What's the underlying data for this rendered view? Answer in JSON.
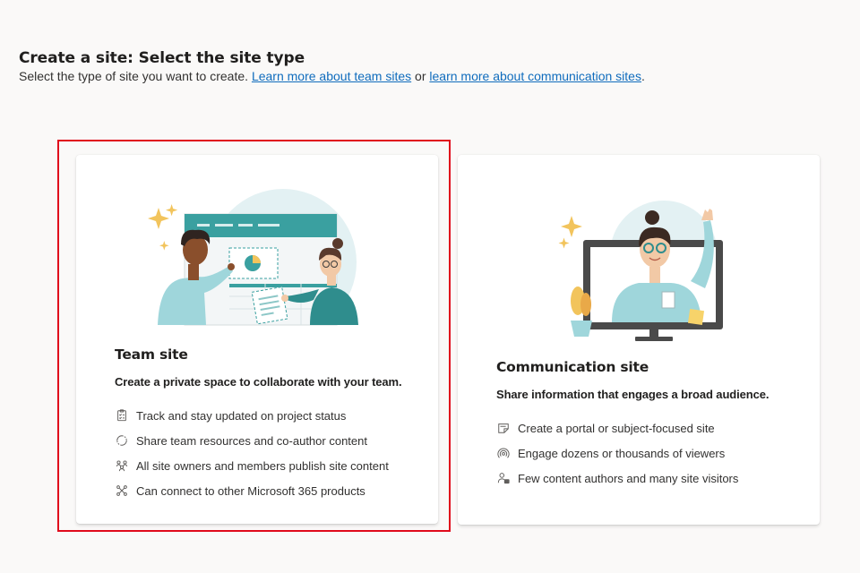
{
  "header": {
    "title": "Create a site: Select the site type",
    "subtitle_prefix": "Select the type of site you want to create. ",
    "link_team": "Learn more about team sites",
    "subtitle_middle": " or ",
    "link_comm": "learn more about communication sites",
    "subtitle_suffix": "."
  },
  "cards": {
    "team": {
      "title": "Team site",
      "description": "Create a private space to collaborate with your team.",
      "features": [
        {
          "icon": "checklist-icon",
          "label": "Track and stay updated on project status"
        },
        {
          "icon": "sync-circle-icon",
          "label": "Share team resources and co-author content"
        },
        {
          "icon": "people-network-icon",
          "label": "All site owners and members publish site content"
        },
        {
          "icon": "connector-icon",
          "label": "Can connect to other Microsoft 365 products"
        }
      ]
    },
    "communication": {
      "title": "Communication site",
      "description": "Share information that engages a broad audience.",
      "features": [
        {
          "icon": "note-edit-icon",
          "label": "Create a portal or subject-focused site"
        },
        {
          "icon": "broadcast-icon",
          "label": "Engage dozens or thousands of viewers"
        },
        {
          "icon": "person-feedback-icon",
          "label": "Few content authors and many site visitors"
        }
      ]
    }
  },
  "colors": {
    "background": "#faf9f8",
    "link": "#0f6cbd",
    "selection_outline": "#e00b1c",
    "teal_accent": "#3aa0a0",
    "illustration_bg": "#e3f1f3"
  }
}
